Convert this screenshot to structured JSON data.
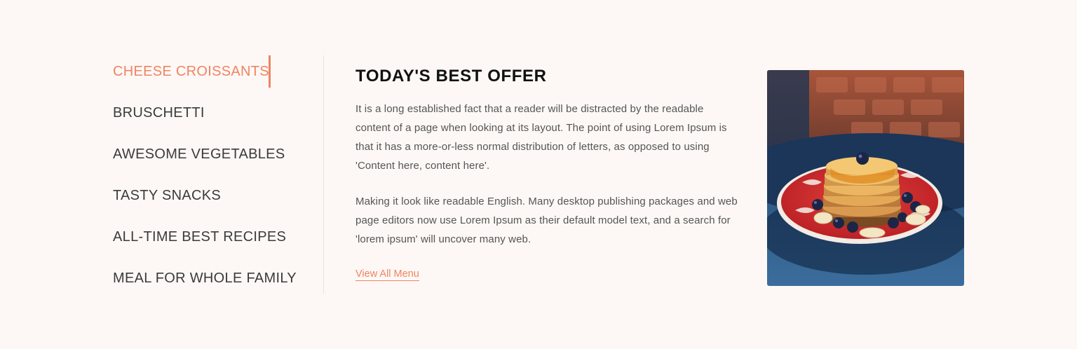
{
  "menu": {
    "items": [
      {
        "label": "CHEESE CROISSANTS",
        "active": true
      },
      {
        "label": "BRUSCHETTI",
        "active": false
      },
      {
        "label": "AWESOME VEGETABLES",
        "active": false
      },
      {
        "label": "TASTY SNACKS",
        "active": false
      },
      {
        "label": "ALL-TIME BEST RECIPES",
        "active": false
      },
      {
        "label": "MEAL FOR WHOLE FAMILY",
        "active": false
      }
    ]
  },
  "offer": {
    "title": "TODAY'S BEST OFFER",
    "paragraph1": "It is a long established fact that a reader will be distracted by the readable content of a page when looking at its layout. The point of using Lorem Ipsum is that it has a more-or-less normal distribution of letters, as opposed to using 'Content here, content here'.",
    "paragraph2": "Making it look like readable English. Many desktop publishing packages and web page editors now use Lorem Ipsum as their default model text, and a search for 'lorem ipsum' will uncover many web.",
    "link_label": "View All Menu"
  },
  "image": {
    "icon": "pancake-stack-photo"
  },
  "colors": {
    "accent": "#f08463",
    "background": "#fdf8f5",
    "heading": "#111111"
  }
}
